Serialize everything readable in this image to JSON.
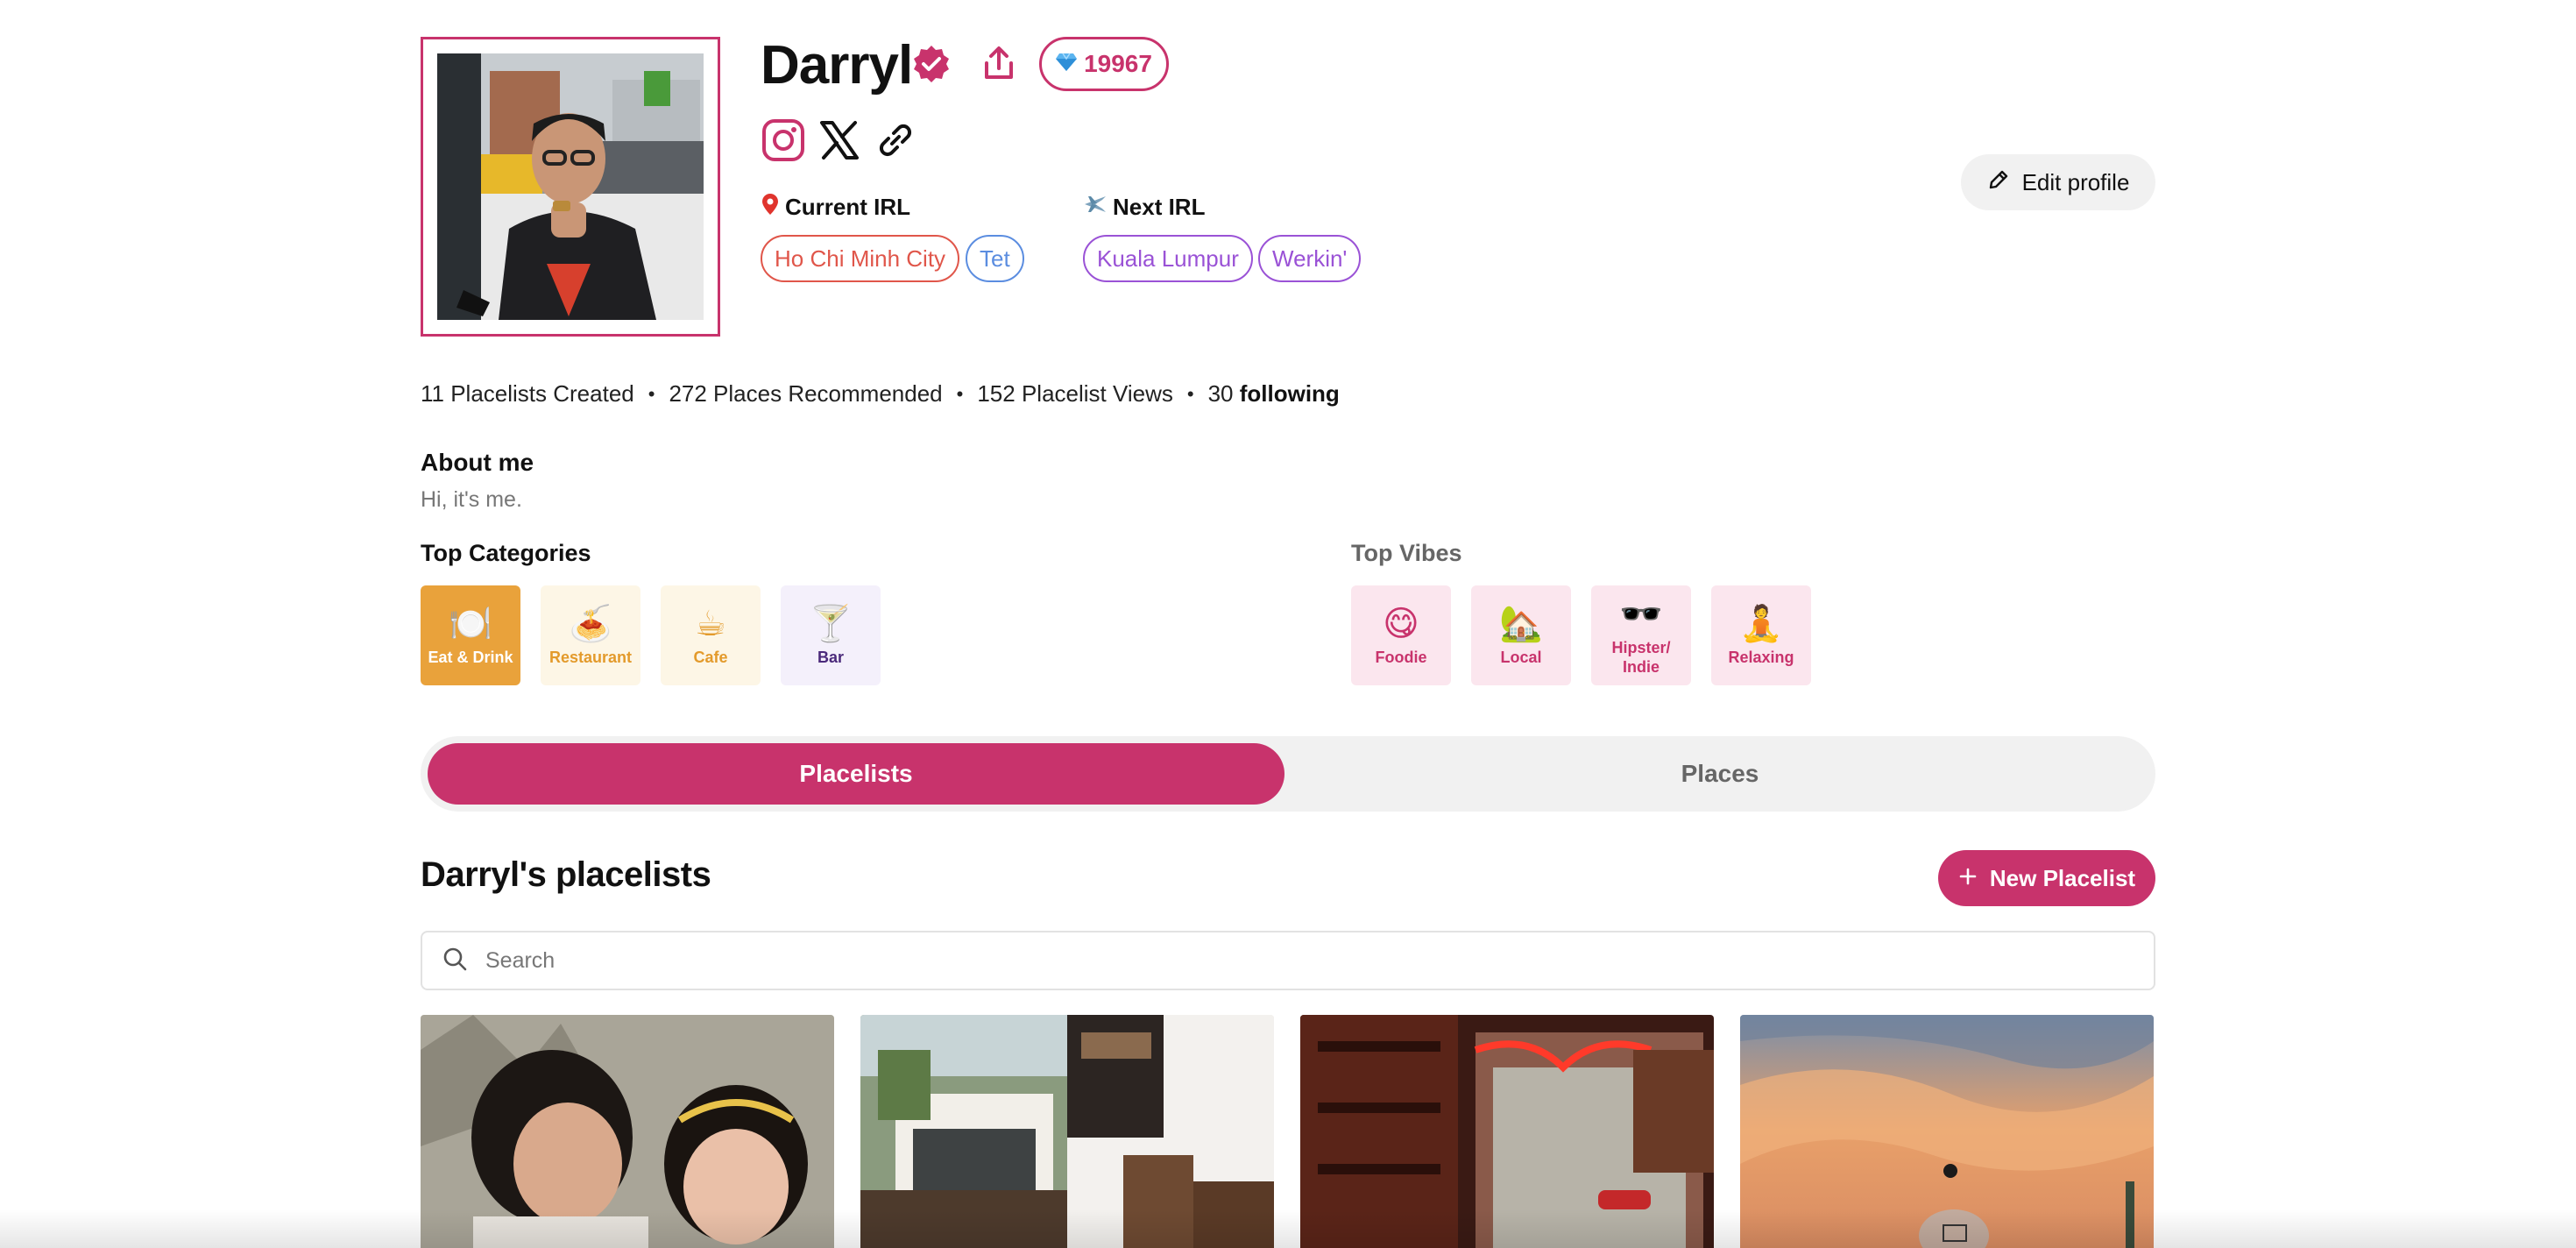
{
  "profile": {
    "name": "Darryl",
    "gems": "19967",
    "gem_icon": "gem-icon"
  },
  "colors": {
    "accent": "#c8336c",
    "current_irl_pill": "#e0564a",
    "tet_pill": "#5b8de0",
    "next_irl_pill": "#9a52d6"
  },
  "irl": {
    "current_label": "Current IRL",
    "current_tags": [
      "Ho Chi Minh City",
      "Tet"
    ],
    "next_label": "Next IRL",
    "next_tags": [
      "Kuala Lumpur",
      "Werkin'"
    ]
  },
  "actions": {
    "edit_profile": "Edit profile",
    "new_placelist": "New Placelist"
  },
  "stats": {
    "placelists": "11 Placelists Created",
    "places": "272 Places Recommended",
    "views": "152 Placelist Views",
    "following_count": "30",
    "following_label": "following"
  },
  "about": {
    "heading": "About me",
    "text": "Hi, it's me."
  },
  "top_categories": {
    "heading": "Top Categories",
    "items": [
      {
        "label": "Eat & Drink",
        "emoji": "🍽️",
        "active": true
      },
      {
        "label": "Restaurant",
        "emoji": "🍝",
        "active": false
      },
      {
        "label": "Cafe",
        "emoji": "☕",
        "active": false
      },
      {
        "label": "Bar",
        "emoji": "🍸",
        "active": false
      }
    ]
  },
  "top_vibes": {
    "heading": "Top Vibes",
    "items": [
      {
        "label": "Foodie",
        "emoji": "😋"
      },
      {
        "label": "Local",
        "emoji": "🏡"
      },
      {
        "label": "Hipster/ Indie",
        "emoji": "🕶️"
      },
      {
        "label": "Relaxing",
        "emoji": "🧘"
      }
    ]
  },
  "tabs": [
    {
      "label": "Placelists",
      "active": true
    },
    {
      "label": "Places",
      "active": false
    }
  ],
  "placelists": {
    "heading": "Darryl's placelists",
    "search_placeholder": "Search"
  }
}
